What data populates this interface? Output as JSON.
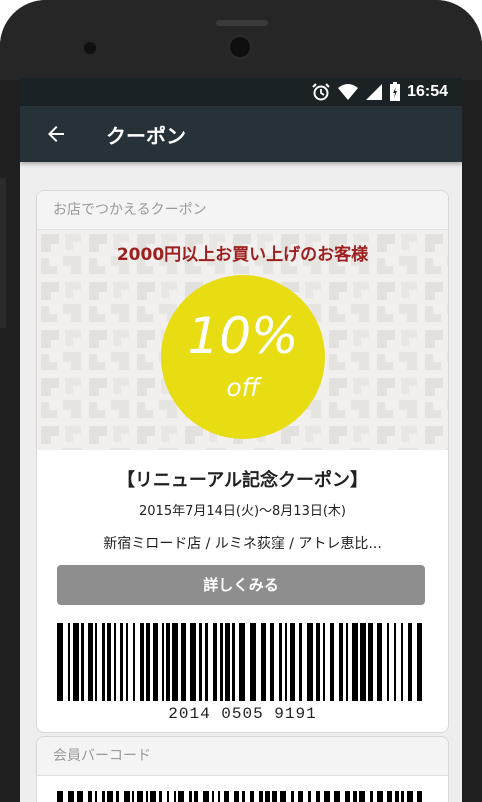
{
  "status": {
    "time": "16:54"
  },
  "appbar": {
    "title": "クーポン"
  },
  "coupon_card": {
    "section_label": "お店でつかえるクーポン",
    "banner_headline": "2000円以上お買い上げのお客様",
    "discount_value": "10%",
    "discount_unit": "off",
    "title": "【リニューアル記念クーポン】",
    "date_range": "2015年7月14日(火)〜8月13日(木)",
    "stores": "新宿ミロード店 / ルミネ荻窪 / アトレ恵比...",
    "detail_button": "詳しくみる",
    "barcode_number": "2014 0505 9191"
  },
  "member_card": {
    "section_label": "会員バーコード"
  },
  "colors": {
    "appbar": "#263238",
    "accent_red": "#9e1f1f",
    "discount_yellow": "#e8dc12",
    "button_gray": "#8e8e8e"
  }
}
